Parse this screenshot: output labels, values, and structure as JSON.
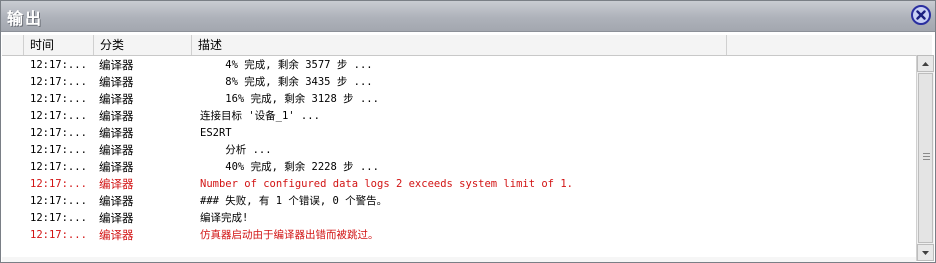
{
  "window": {
    "title": "输出"
  },
  "columns": {
    "time": "时间",
    "category": "分类",
    "description": "描述"
  },
  "rows": [
    {
      "time": "12:17:...",
      "category": "编译器",
      "description": "    4% 完成, 剩余 3577 步 ...",
      "level": "info"
    },
    {
      "time": "12:17:...",
      "category": "编译器",
      "description": "    8% 完成, 剩余 3435 步 ...",
      "level": "info"
    },
    {
      "time": "12:17:...",
      "category": "编译器",
      "description": "    16% 完成, 剩余 3128 步 ...",
      "level": "info"
    },
    {
      "time": "12:17:...",
      "category": "编译器",
      "description": "连接目标 '设备_1' ...",
      "level": "info"
    },
    {
      "time": "12:17:...",
      "category": "编译器",
      "description": "ES2RT",
      "level": "info"
    },
    {
      "time": "12:17:...",
      "category": "编译器",
      "description": "    分析 ...",
      "level": "info"
    },
    {
      "time": "12:17:...",
      "category": "编译器",
      "description": "    40% 完成, 剩余 2228 步 ...",
      "level": "info"
    },
    {
      "time": "12:17:...",
      "category": "编译器",
      "description": "Number of configured data logs 2 exceeds system limit of 1.",
      "level": "error"
    },
    {
      "time": "12:17:...",
      "category": "编译器",
      "description": "### 失败, 有 1 个错误, 0 个警告。",
      "level": "info"
    },
    {
      "time": "12:17:...",
      "category": "编译器",
      "description": "编译完成!",
      "level": "info"
    },
    {
      "time": "12:17:...",
      "category": "编译器",
      "description": "仿真器启动由于编译器出错而被跳过。",
      "level": "error"
    }
  ],
  "colors": {
    "error": "#d21414",
    "info": "#000000",
    "close_ring": "#2a2fa0"
  },
  "icons": {
    "close": "close-icon",
    "scroll_up": "arrow-up-icon",
    "scroll_down": "arrow-down-icon"
  }
}
